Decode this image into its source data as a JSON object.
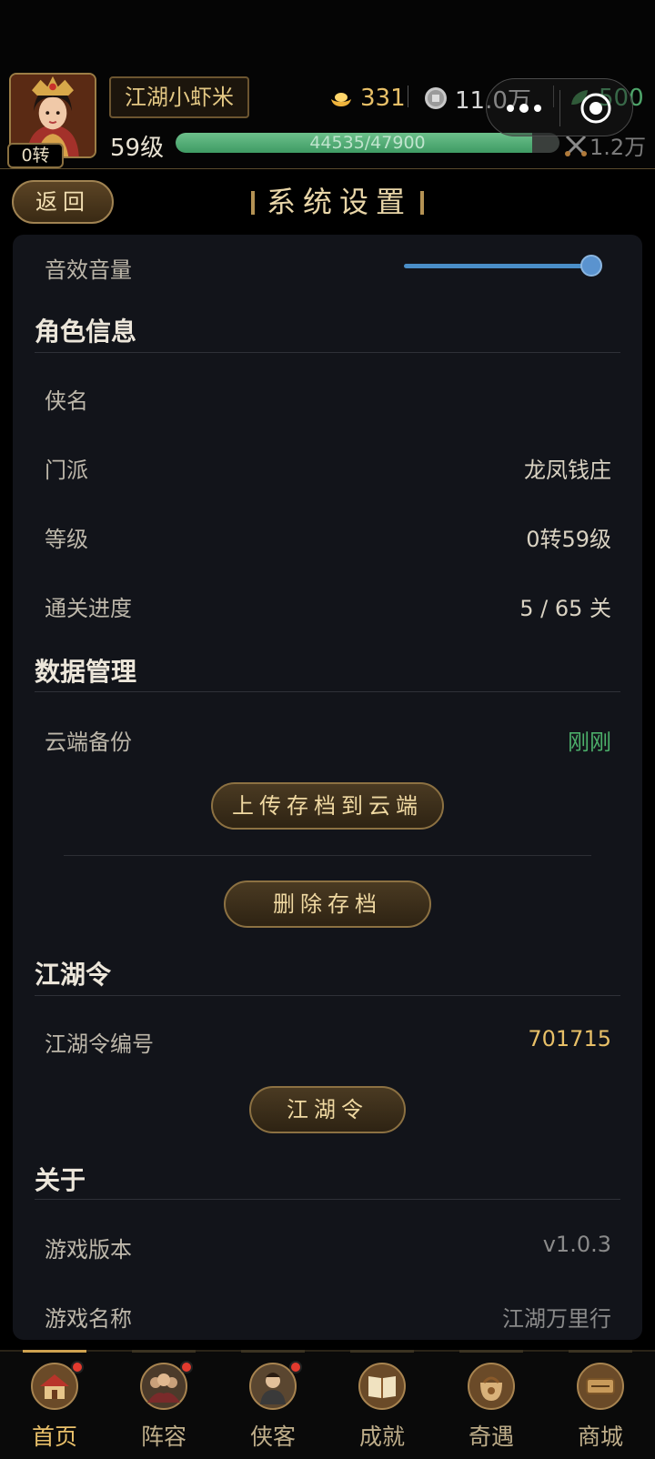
{
  "player": {
    "name": "江湖小虾米",
    "rebirth": "0转",
    "level": "59级",
    "exp_text": "44535/47900",
    "exp_fraction": 0.9297,
    "currencies": {
      "gold": "331",
      "silver": "11.0万",
      "jade": "500",
      "power": "1.2万"
    }
  },
  "header": {
    "back_label": "返回",
    "title": "系统设置"
  },
  "settings": {
    "sound_label": "音效音量",
    "sound_level": 1.0,
    "sections": {
      "character": {
        "title": "角色信息",
        "name_label": "侠名",
        "name_value": "",
        "sect_label": "门派",
        "sect_value": "龙凤钱庄",
        "level_label": "等级",
        "level_value": "0转59级",
        "progress_label": "通关进度",
        "progress_value": "5 / 65 关"
      },
      "data": {
        "title": "数据管理",
        "backup_label": "云端备份",
        "backup_value": "刚刚",
        "upload_button": "上传存档到云端",
        "delete_button": "删除存档"
      },
      "token": {
        "title": "江湖令",
        "id_label": "江湖令编号",
        "id_value": "701715",
        "button": "江湖令"
      },
      "about": {
        "title": "关于",
        "version_label": "游戏版本",
        "version_value": "v1.0.3",
        "game_name_label": "游戏名称",
        "game_name_value": "江湖万里行"
      }
    }
  },
  "nav": {
    "tabs": [
      {
        "label": "首页",
        "icon": "home-icon",
        "badge": true,
        "active": true
      },
      {
        "label": "阵容",
        "icon": "team-icon",
        "badge": true,
        "active": false
      },
      {
        "label": "侠客",
        "icon": "hero-icon",
        "badge": true,
        "active": false
      },
      {
        "label": "成就",
        "icon": "book-icon",
        "badge": false,
        "active": false
      },
      {
        "label": "奇遇",
        "icon": "bag-icon",
        "badge": false,
        "active": false
      },
      {
        "label": "商城",
        "icon": "shop-icon",
        "badge": false,
        "active": false
      }
    ]
  },
  "colors": {
    "accent_gold": "#e8c068",
    "success_green": "#4caf6a",
    "exp_green": "#4fae74",
    "slider_blue": "#4a8ec8",
    "badge_red": "#e23a2e"
  }
}
